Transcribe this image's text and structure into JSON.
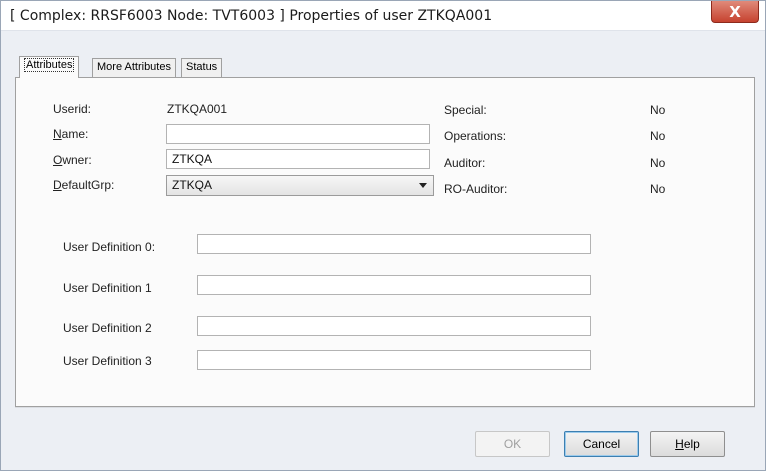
{
  "window": {
    "title": "[ Complex: RRSF6003 Node: TVT6003 ] Properties of user ZTKQA001",
    "close_symbol": "X"
  },
  "tabs": [
    {
      "label": "Attributes",
      "active": true
    },
    {
      "label": "More Attributes",
      "active": false
    },
    {
      "label": "Status",
      "active": false
    }
  ],
  "attributes": {
    "userid_label": "Userid:",
    "userid_value": "ZTKQA001",
    "name_label_accel": "N",
    "name_label_rest": "ame:",
    "name_value": "",
    "owner_label_accel": "O",
    "owner_label_rest": "wner:",
    "owner_value": "ZTKQA",
    "defaultgrp_label_accel": "D",
    "defaultgrp_label_rest": "efaultGrp:",
    "defaultgrp_value": "ZTKQA",
    "flags": [
      {
        "label": "Special:",
        "value": "No"
      },
      {
        "label": "Operations:",
        "value": "No"
      },
      {
        "label": "Auditor:",
        "value": "No"
      },
      {
        "label": "RO-Auditor:",
        "value": "No"
      }
    ],
    "user_definitions": [
      {
        "label": "User Definition 0:",
        "value": ""
      },
      {
        "label": "User Definition 1",
        "value": ""
      },
      {
        "label": "User Definition 2",
        "value": ""
      },
      {
        "label": "User Definition 3",
        "value": ""
      }
    ]
  },
  "buttons": {
    "ok": "OK",
    "cancel": "Cancel",
    "help_accel": "H",
    "help_rest": "elp"
  },
  "colors": {
    "close_button": "#c6422f",
    "dialog_background": "#eceff4"
  }
}
